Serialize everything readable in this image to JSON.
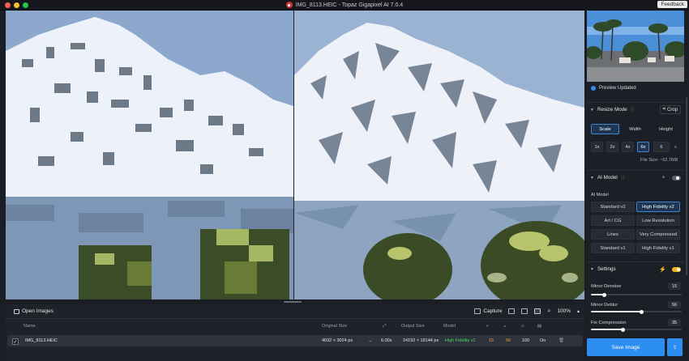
{
  "window": {
    "title": "IMG_8113.HEIC - Topaz Gigapixel AI 7.0.4",
    "feedback_label": "Feedback"
  },
  "bottom": {
    "open_images_label": "Open Images",
    "capture_label": "Capture",
    "zoom": "100%",
    "columns": {
      "name": "Name",
      "original_size": "Original Size",
      "output_size": "Output Size",
      "model": "Model"
    },
    "file": {
      "name": "IMG_8113.HEIC",
      "original_size": "4032 × 3024 px",
      "scale": "6.00x",
      "output_size": "24192 × 18144 px",
      "model": "High Fidelity v2",
      "v1": "15",
      "v2": "56",
      "v3": "100",
      "v4": "On"
    }
  },
  "sidebar": {
    "preview_status": "Preview Updated",
    "resize_mode": {
      "title": "Resize Mode",
      "crop_label": "Crop",
      "modes": [
        "Scale",
        "Width",
        "Height"
      ],
      "scales": [
        "1x",
        "2x",
        "4x",
        "6x"
      ],
      "custom_scale": "6",
      "custom_unit": "x",
      "file_size": "File Size: ~52.7MB"
    },
    "ai_model": {
      "title": "AI Model",
      "label": "AI Model",
      "models": [
        "Standard v2",
        "High Fidelity v2",
        "Art / CG",
        "Low Resolution",
        "Lines",
        "Very Compressed",
        "Standard v1",
        "High Fidelity v1"
      ],
      "selected": "High Fidelity v2"
    },
    "settings": {
      "title": "Settings",
      "sliders": [
        {
          "label": "Minor Denoise",
          "value": "15",
          "fraction": 0.15
        },
        {
          "label": "Minor Deblur",
          "value": "56",
          "fraction": 0.56
        },
        {
          "label": "Fix Compression",
          "value": "35",
          "fraction": 0.35
        }
      ]
    },
    "save_label": "Save Image"
  },
  "colors": {
    "accent": "#2b8ef0",
    "model_green": "#4cd964",
    "value_orange": "#f2a43a",
    "toggle_on": "#f2b51f"
  }
}
